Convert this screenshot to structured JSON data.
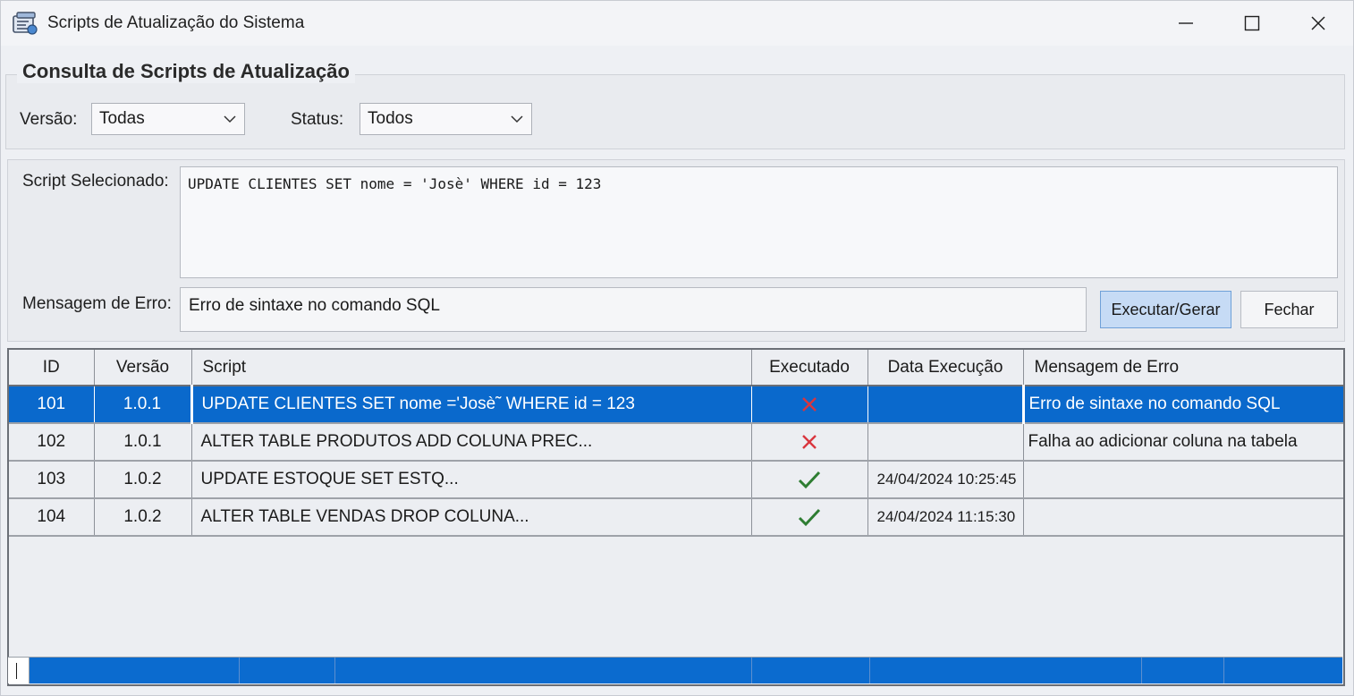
{
  "window": {
    "title": "Scripts de Atualização do Sistema",
    "icon": "database-scripts-icon",
    "controls": [
      "minimize-icon",
      "maximize-icon",
      "close-icon"
    ]
  },
  "filters": {
    "group_title": "Consulta de Scripts de Atualização",
    "version_label": "Versão:",
    "version_value": "Todas",
    "status_label": "Status:",
    "status_value": "Todos"
  },
  "details": {
    "script_label": "Script Selecionado:",
    "script_value": "UPDATE CLIENTES SET nome = 'Josè' WHERE id = 123",
    "error_label": "Mensagem de Erro:",
    "error_value": "Erro de sintaxe no comando SQL",
    "execute_button": "Executar/Gerar",
    "close_button": "Fechar"
  },
  "grid": {
    "columns": [
      "ID",
      "Versão",
      "Script",
      "Executado",
      "Data Execução",
      "Mensagem de Erro"
    ],
    "rows": [
      {
        "id": "101",
        "version": "1.0.1",
        "script": "UPDATE CLIENTES SET nome ='Josè˜ WHERE id = 123",
        "executed": "no",
        "date": "",
        "error": "Erro de sintaxe no comando SQL",
        "selected": true
      },
      {
        "id": "102",
        "version": "1.0.1",
        "script": "ALTER TABLE PRODUTOS ADD COLUNA PREC...",
        "executed": "no",
        "date": "",
        "error": "Falha ao adicionar coluna na tabela",
        "selected": false
      },
      {
        "id": "103",
        "version": "1.0.2",
        "script": "UPDATE ESTOQUE SET ESTQ...",
        "executed": "yes",
        "date": "24/04/2024 10:25:45",
        "error": "",
        "selected": false
      },
      {
        "id": "104",
        "version": "1.0.2",
        "script": "ALTER TABLE VENDAS DROP COLUNA...",
        "executed": "yes",
        "date": "24/04/2024 11:15:30",
        "error": "",
        "selected": false
      }
    ]
  },
  "icons": {
    "executed_yes": "check-icon",
    "executed_no": "cross-icon",
    "combo_arrow": "chevron-down-icon"
  },
  "colors": {
    "selection": "#0a69cc",
    "check": "#2e7d32",
    "cross": "#d9363e",
    "primary_button": "#c6dbf5"
  }
}
